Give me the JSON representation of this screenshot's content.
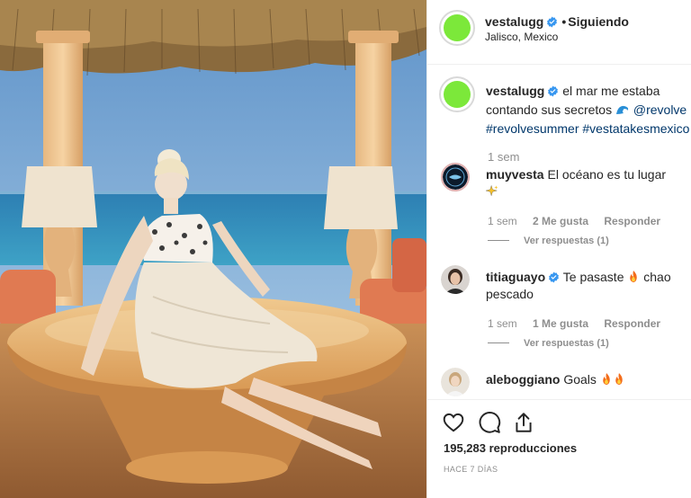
{
  "post": {
    "author": "vestalugg",
    "follow_separator": "•",
    "follow_label": "Siguiendo",
    "location": "Jalisco, Mexico",
    "avatar_color": "#7ce83a",
    "verified_color": "#3897f0"
  },
  "caption": {
    "username": "vestalugg",
    "text_before": "el mar me estaba contando sus secretos",
    "mention": "@revolve",
    "hashtags": "#revolvesummer #vestatakesmexico",
    "emoji_icon": "water-wave-icon",
    "time": "1 sem"
  },
  "comments": [
    {
      "username": "muyvesta",
      "text": "El océano es tu lugar",
      "emoji_icon": "sparkles-icon",
      "time": "1 sem",
      "likes": "2 Me gusta",
      "reply_label": "Responder",
      "view_replies": "Ver respuestas (1)"
    },
    {
      "username": "titiaguayo",
      "verified": true,
      "text_a": "Te pasaste",
      "emoji_icon": "fire-icon",
      "text_b": "chao pescado",
      "time": "1 sem",
      "likes": "1 Me gusta",
      "reply_label": "Responder",
      "view_replies": "Ver respuestas (1)"
    },
    {
      "username": "aleboggiano",
      "text": "Goals",
      "emoji_icon": "fire-icon"
    }
  ],
  "actions": {
    "views": "195,283 reproducciones",
    "posted_ago": "HACE 7 DÍAS"
  },
  "colors": {
    "link": "#00376b",
    "muted": "#8e8e8e",
    "text": "#262626"
  }
}
